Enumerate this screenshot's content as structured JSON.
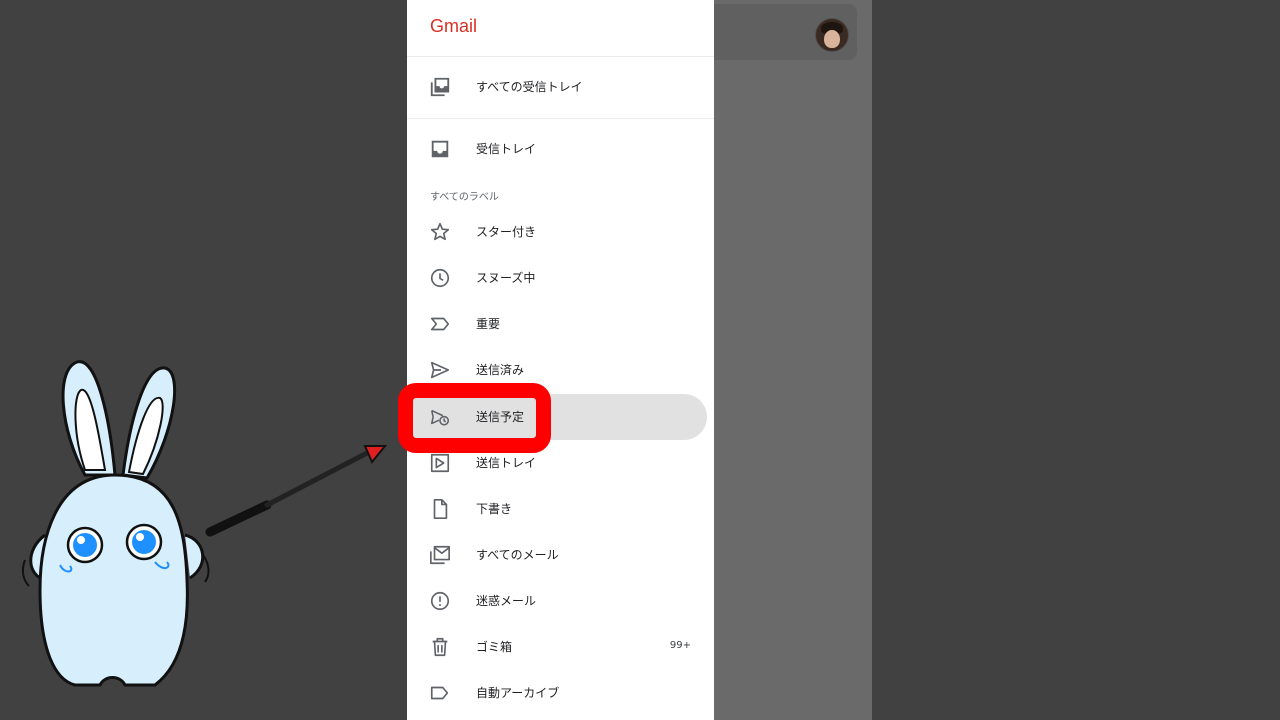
{
  "app": {
    "brand": "Gmail"
  },
  "drawer": {
    "top_items": [
      {
        "label": "すべての受信トレイ",
        "icon": "all-inboxes-icon"
      },
      {
        "label": "受信トレイ",
        "icon": "inbox-icon"
      }
    ],
    "section_label": "すべてのラベル",
    "label_items": [
      {
        "label": "スター付き",
        "icon": "star-icon",
        "count": ""
      },
      {
        "label": "スヌーズ中",
        "icon": "clock-icon",
        "count": ""
      },
      {
        "label": "重要",
        "icon": "important-icon",
        "count": ""
      },
      {
        "label": "送信済み",
        "icon": "send-icon",
        "count": ""
      },
      {
        "label": "送信予定",
        "icon": "scheduled-send-icon",
        "count": "",
        "active": true
      },
      {
        "label": "送信トレイ",
        "icon": "outbox-icon",
        "count": ""
      },
      {
        "label": "下書き",
        "icon": "draft-icon",
        "count": ""
      },
      {
        "label": "すべてのメール",
        "icon": "all-mail-icon",
        "count": ""
      },
      {
        "label": "迷惑メール",
        "icon": "spam-icon",
        "count": ""
      },
      {
        "label": "ゴミ箱",
        "icon": "trash-icon",
        "count": "99+"
      },
      {
        "label": "自動アーカイブ",
        "icon": "label-icon",
        "count": ""
      }
    ]
  },
  "colors": {
    "brand": "#d93025",
    "highlight": "#ff0000",
    "active_bg": "#e1e1e1",
    "backdrop": "#414141"
  }
}
